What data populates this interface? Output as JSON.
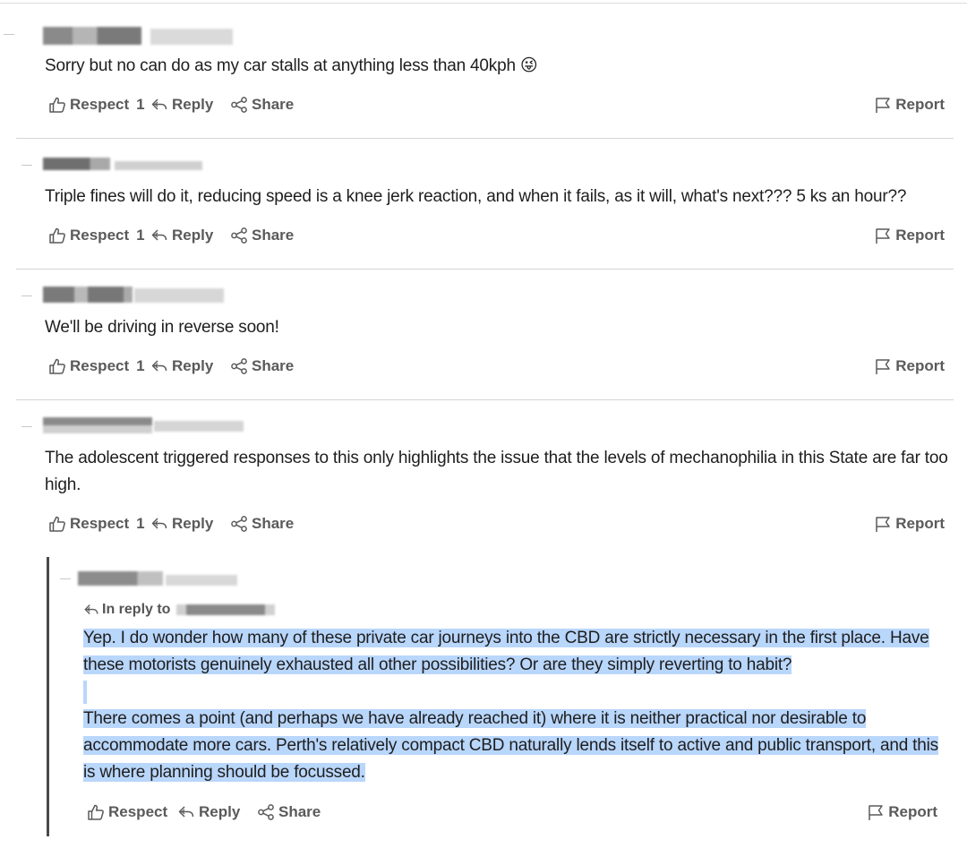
{
  "comments": [
    {
      "text": "Sorry but no can do as my car stalls at anything less than 40kph 😜",
      "respect_label": "Respect",
      "respect_count": "1",
      "reply_label": "Reply",
      "share_label": "Share",
      "report_label": "Report"
    },
    {
      "text": "Triple fines will do it, reducing speed is a knee jerk reaction, and when it fails, as it will, what's next??? 5 ks an hour??",
      "respect_label": "Respect",
      "respect_count": "1",
      "reply_label": "Reply",
      "share_label": "Share",
      "report_label": "Report"
    },
    {
      "text": "We'll be driving in reverse soon!",
      "respect_label": "Respect",
      "respect_count": "1",
      "reply_label": "Reply",
      "share_label": "Share",
      "report_label": "Report"
    },
    {
      "text": "The adolescent triggered responses to this only highlights the issue that the levels of mechanophilia in this State are far too high.",
      "respect_label": "Respect",
      "respect_count": "1",
      "reply_label": "Reply",
      "share_label": "Share",
      "report_label": "Report"
    }
  ],
  "reply": {
    "in_reply_to_label": "In reply to",
    "paragraph1": "Yep. I do wonder how many of these private car journeys into the CBD are strictly necessary in the first place. Have these motorists genuinely exhausted all other possibilities? Or are they simply reverting to habit?",
    "paragraph2": "There comes a point (and perhaps we have already reached it) where it is neither practical nor desirable to accommodate more cars. Perth's relatively compact CBD naturally lends itself to active and public transport, and this is where planning should be focussed.",
    "respect_label": "Respect",
    "reply_label": "Reply",
    "share_label": "Share",
    "report_label": "Report"
  },
  "colors": {
    "highlight": "#b9d6fb",
    "action_text": "#5a5a5a",
    "separator": "#d5d5d5"
  },
  "icons": [
    "thumbs-up-icon",
    "reply-arrow-icon",
    "share-icon",
    "flag-icon"
  ]
}
